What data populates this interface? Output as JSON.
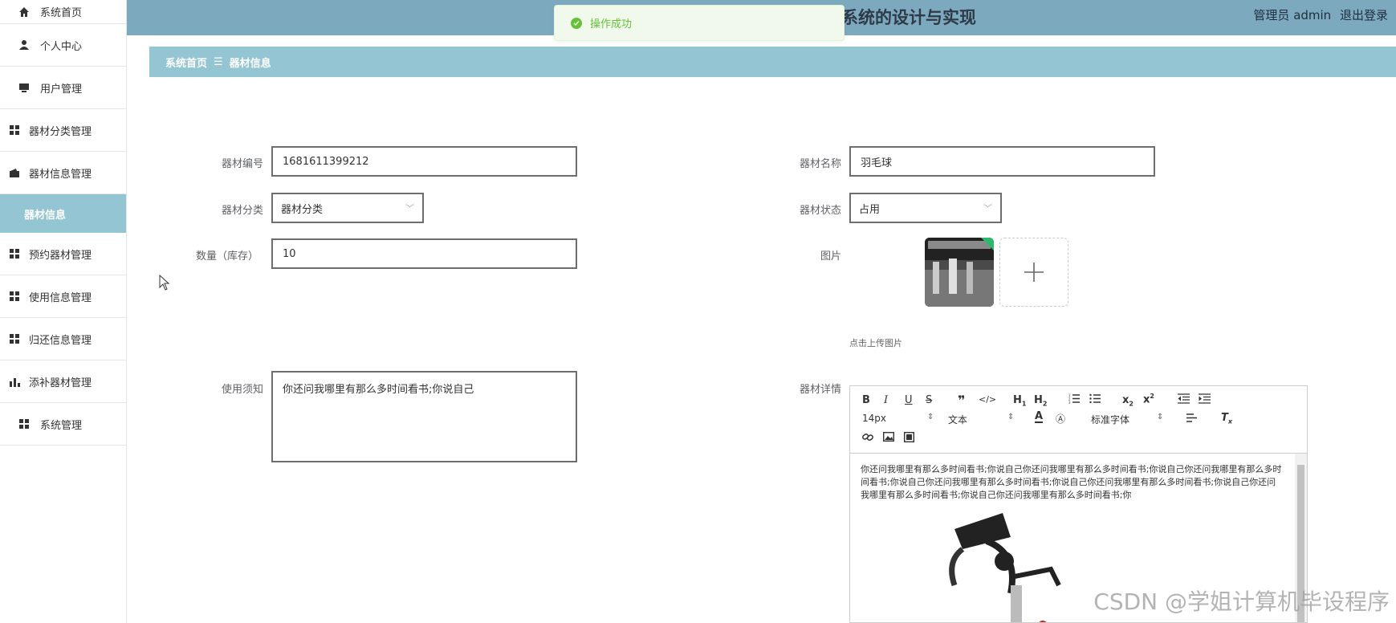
{
  "sidebar": {
    "items": [
      {
        "label": "系统首页",
        "icon": "home-icon"
      },
      {
        "label": "个人中心",
        "icon": "user-icon"
      },
      {
        "label": "用户管理",
        "icon": "monitor-icon"
      },
      {
        "label": "器材分类管理",
        "icon": "grid-icon"
      },
      {
        "label": "器材信息管理",
        "icon": "wallet-icon"
      },
      {
        "label": "器材信息",
        "icon": ""
      },
      {
        "label": "预约器材管理",
        "icon": "grid-icon"
      },
      {
        "label": "使用信息管理",
        "icon": "grid-icon"
      },
      {
        "label": "归还信息管理",
        "icon": "grid-icon"
      },
      {
        "label": "添补器材管理",
        "icon": "bar-chart-icon"
      },
      {
        "label": "系统管理",
        "icon": "grid-icon"
      }
    ]
  },
  "header": {
    "title": "系统的设计与实现",
    "user": "管理员 admin",
    "logout": "退出登录"
  },
  "toast": {
    "message": "操作成功"
  },
  "breadcrumb": {
    "home": "系统首页",
    "sep": "☰",
    "current": "器材信息"
  },
  "form": {
    "code_label": "器材编号",
    "code_value": "1681611399212",
    "name_label": "器材名称",
    "name_value": "羽毛球",
    "category_label": "器材分类",
    "category_value": "器材分类",
    "status_label": "器材状态",
    "status_value": "占用",
    "qty_label": "数量（库存）",
    "qty_value": "10",
    "image_label": "图片",
    "upload_hint": "点击上传图片",
    "notice_label": "使用须知",
    "notice_value": "你还问我哪里有那么多时间看书;你说自己",
    "detail_label": "器材详情"
  },
  "editor": {
    "font_size": "14px",
    "block_type": "文本",
    "font_family": "标准字体",
    "content": "你还问我哪里有那么多时间看书;你说自己你还问我哪里有那么多时间看书;你说自己你还问我哪里有那么多时间看书;你说自己你还问我哪里有那么多时间看书;你说自己你还问我哪里有那么多时间看书;你说自己你还问我哪里有那么多时间看书;你说自己你还问我哪里有那么多时间看书;你"
  },
  "watermark": "CSDN @学姐计算机毕设程序",
  "colors": {
    "header": "#7da9bf",
    "accent": "#94c5d3",
    "success": "#67c23a"
  }
}
